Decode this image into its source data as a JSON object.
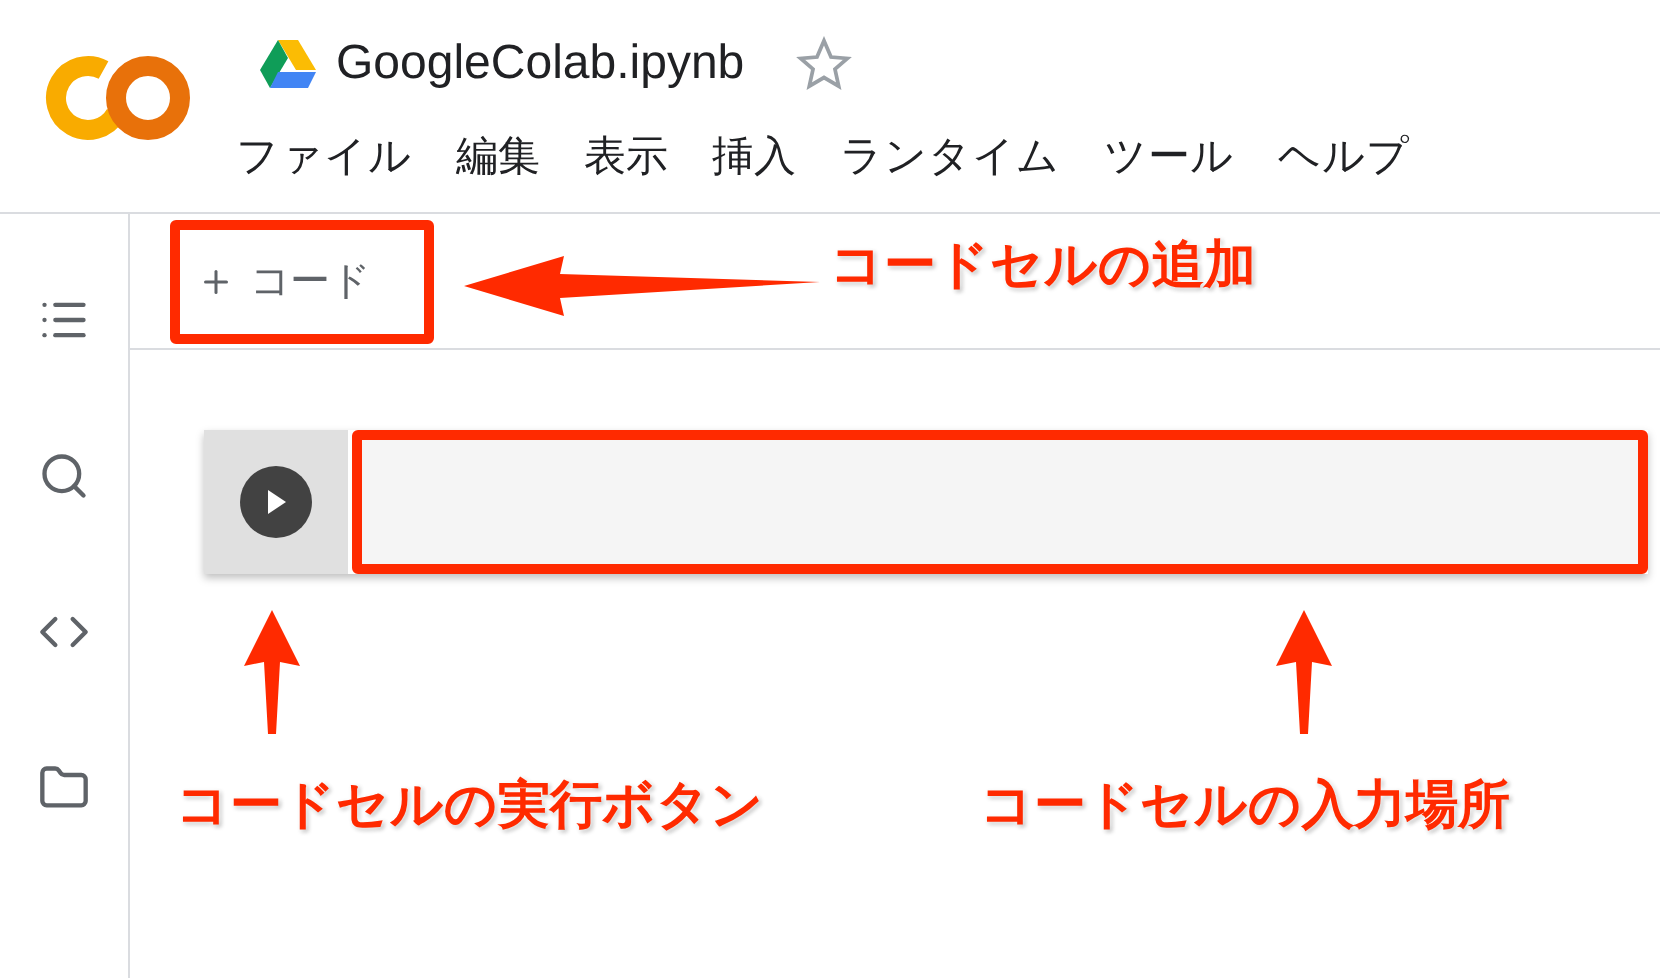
{
  "header": {
    "title": "GoogleColab.ipynb",
    "starred": false
  },
  "menu": [
    "ファイル",
    "編集",
    "表示",
    "挿入",
    "ランタイム",
    "ツール",
    "ヘルプ"
  ],
  "toolbar": [
    {
      "label": "コード",
      "kind": "code"
    }
  ],
  "annotations": [
    "コードセルの追加",
    "コードセルの実行ボタン",
    "コードセルの入力場所"
  ]
}
